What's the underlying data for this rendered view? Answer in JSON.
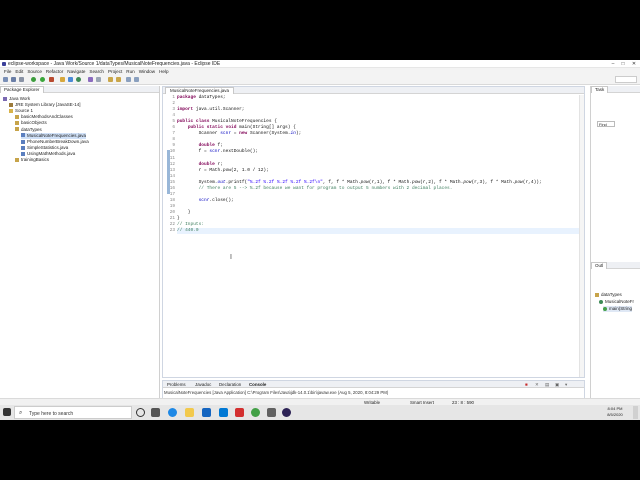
{
  "window": {
    "title": "eclipse-workspace - Java Work/Source 1/dataTypes/MusicalNoteFrequencies.java - Eclipse IDE"
  },
  "menu": [
    "File",
    "Edit",
    "Source",
    "Refactor",
    "Navigate",
    "Search",
    "Project",
    "Run",
    "Window",
    "Help"
  ],
  "toolbar": {
    "quick_access_value": ""
  },
  "package_explorer": {
    "tab_label": "Package Explorer",
    "tree": [
      {
        "label": "Java Work",
        "indent": 0,
        "icon": "project-icon"
      },
      {
        "label": "JRE System Library [JavaSE-14]",
        "indent": 1,
        "icon": "library-icon"
      },
      {
        "label": "Source 1",
        "indent": 1,
        "icon": "folder-icon"
      },
      {
        "label": "basicMethodsAndClasses",
        "indent": 2,
        "icon": "package-icon"
      },
      {
        "label": "basicObjects",
        "indent": 2,
        "icon": "package-icon"
      },
      {
        "label": "dataTypes",
        "indent": 2,
        "icon": "package-icon"
      },
      {
        "label": "MusicalNoteFrequencies.java",
        "indent": 3,
        "icon": "java-file-icon",
        "selected": true
      },
      {
        "label": "PhoneNumberBreakDown.java",
        "indent": 3,
        "icon": "java-file-icon"
      },
      {
        "label": "SimpleStatistics.java",
        "indent": 3,
        "icon": "java-file-icon"
      },
      {
        "label": "UsingMathMethods.java",
        "indent": 3,
        "icon": "java-file-icon"
      },
      {
        "label": "trainingBasics",
        "indent": 2,
        "icon": "package-icon"
      }
    ]
  },
  "editor": {
    "tab_label": "MusicalNoteFrequencies.java",
    "lines": [
      {
        "n": "1",
        "html": "<span class='kw'>package</span> dataTypes;"
      },
      {
        "n": "2",
        "html": ""
      },
      {
        "n": "3",
        "html": "<span class='kw'>import</span> java.util.Scanner;"
      },
      {
        "n": "4",
        "html": ""
      },
      {
        "n": "5",
        "html": "<span class='kw'>public class</span> MusicalNoteFrequencies {"
      },
      {
        "n": "6",
        "html": "    <span class='kw'>public static void</span> main(String[] args) {"
      },
      {
        "n": "7",
        "html": "        Scanner <span class='fd'>scnr</span> = <span class='kw'>new</span> Scanner(System.<span class='fd'><i>in</i></span>);"
      },
      {
        "n": "8",
        "html": ""
      },
      {
        "n": "9",
        "html": "        <span class='kw'>double</span> f;"
      },
      {
        "n": "10",
        "html": "        f = <span class='fd'>scnr</span>.nextDouble();"
      },
      {
        "n": "11",
        "html": ""
      },
      {
        "n": "12",
        "html": "        <span class='kw'>double</span> r;"
      },
      {
        "n": "13",
        "html": "        r = Math.<i>pow</i>(2, 1.0 / 12);"
      },
      {
        "n": "14",
        "html": ""
      },
      {
        "n": "15",
        "html": "        System.<span class='fd'><i>out</i></span>.printf(<span class='st'>\"%.2f %.2f %.2f %.2f %.2f\\n\"</span>, f, f * Math.<i>pow</i>(r,1), f * Math.<i>pow</i>(r,2), f * Math.<i>pow</i>(r,3), f * Math.<i>pow</i>(r,4));"
      },
      {
        "n": "16",
        "html": "        <span class='cm'>// There are 5 --> %.2f because we want for program to output 5 numbers with 2 decimal places.</span>"
      },
      {
        "n": "17",
        "html": ""
      },
      {
        "n": "18",
        "html": "        <span class='fd'>scnr</span>.close();"
      },
      {
        "n": "19",
        "html": ""
      },
      {
        "n": "20",
        "html": "    }"
      },
      {
        "n": "21",
        "html": "}"
      },
      {
        "n": "22",
        "html": "<span class='cm'>// Inputs:</span>"
      },
      {
        "n": "23",
        "html": "<span class='cm'>// 440.0</span>"
      }
    ]
  },
  "right_panel": {
    "task_tab": "Task",
    "find_placeholder": "Find",
    "outline_tab": "Outl",
    "outline_items": [
      "dataTypes",
      "MusicalNoteFr",
      "main(String"
    ]
  },
  "console": {
    "tabs": [
      "Problems",
      "Javadoc",
      "Declaration",
      "Console"
    ],
    "terminated": "MusicalNoteFrequencies [Java Application] C:\\Program Files\\Java\\jdk-14.0.1\\bin\\javaw.exe (Aug 5, 2020, 8:04:29 PM)"
  },
  "status": {
    "writable": "Writable",
    "insert": "Smart Insert",
    "position": "23 : 8 : 590"
  },
  "taskbar": {
    "search_label": "Type here to search",
    "time": "8:04 PM",
    "date": "8/5/2020"
  }
}
